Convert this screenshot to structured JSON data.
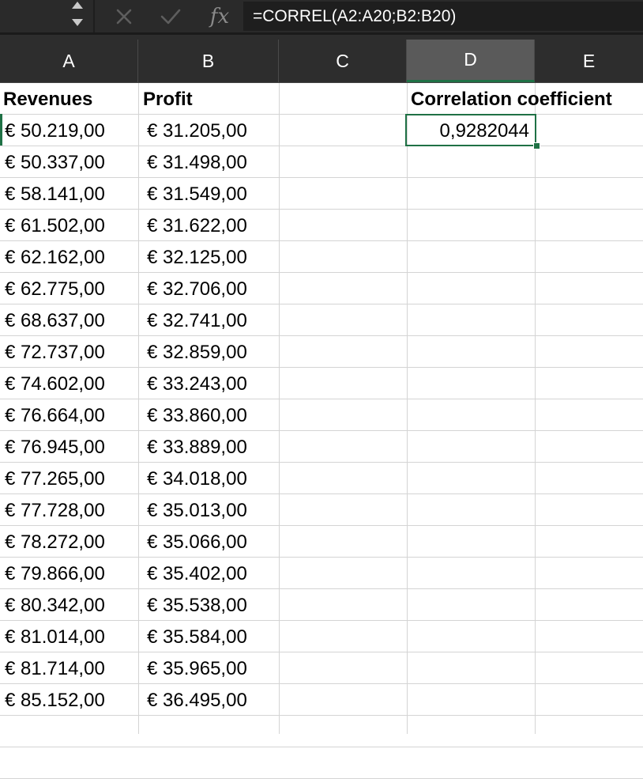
{
  "formula_bar": {
    "formula": "=CORREL(A2:A20;B2:B20)",
    "fx_label": "fx"
  },
  "columns": [
    "A",
    "B",
    "C",
    "D",
    "E"
  ],
  "selected_column": "D",
  "headers": {
    "a": "Revenues",
    "b": "Profit",
    "d": "Correlation coefficient"
  },
  "result": "0,9282044",
  "rows": [
    {
      "revenue": "€ 50.219,00",
      "profit": "€ 31.205,00"
    },
    {
      "revenue": "€ 50.337,00",
      "profit": "€ 31.498,00"
    },
    {
      "revenue": "€ 58.141,00",
      "profit": "€ 31.549,00"
    },
    {
      "revenue": "€ 61.502,00",
      "profit": "€ 31.622,00"
    },
    {
      "revenue": "€ 62.162,00",
      "profit": "€ 32.125,00"
    },
    {
      "revenue": "€ 62.775,00",
      "profit": "€ 32.706,00"
    },
    {
      "revenue": "€ 68.637,00",
      "profit": "€ 32.741,00"
    },
    {
      "revenue": "€ 72.737,00",
      "profit": "€ 32.859,00"
    },
    {
      "revenue": "€ 74.602,00",
      "profit": "€ 33.243,00"
    },
    {
      "revenue": "€ 76.664,00",
      "profit": "€ 33.860,00"
    },
    {
      "revenue": "€ 76.945,00",
      "profit": "€ 33.889,00"
    },
    {
      "revenue": "€ 77.265,00",
      "profit": "€ 34.018,00"
    },
    {
      "revenue": "€ 77.728,00",
      "profit": "€ 35.013,00"
    },
    {
      "revenue": "€ 78.272,00",
      "profit": "€ 35.066,00"
    },
    {
      "revenue": "€ 79.866,00",
      "profit": "€ 35.402,00"
    },
    {
      "revenue": "€ 80.342,00",
      "profit": "€ 35.538,00"
    },
    {
      "revenue": "€ 81.014,00",
      "profit": "€ 35.584,00"
    },
    {
      "revenue": "€ 81.714,00",
      "profit": "€ 35.965,00"
    },
    {
      "revenue": "€ 85.152,00",
      "profit": "€ 36.495,00"
    }
  ]
}
